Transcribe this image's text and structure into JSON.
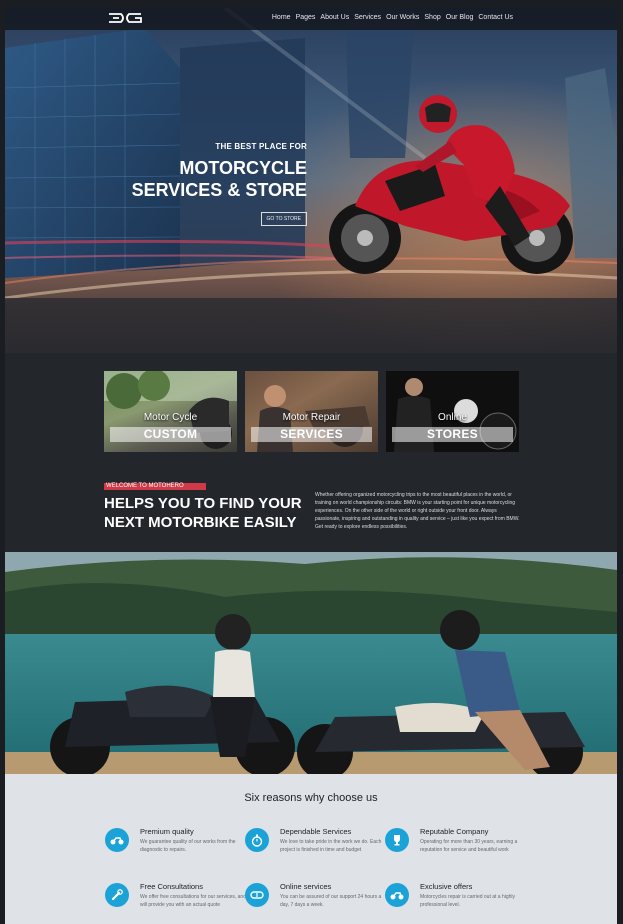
{
  "nav": {
    "items": [
      "Home",
      "Pages",
      "About Us",
      "Services",
      "Our Works",
      "Shop",
      "Our Blog",
      "Contact Us"
    ]
  },
  "hero": {
    "kicker": "THE BEST PLACE FOR",
    "title_line1": "MOTORCYCLE",
    "title_line2": "SERVICES & STORE",
    "button": "GO TO STORE"
  },
  "cards": [
    {
      "small": "Motor Cycle",
      "big": "CUSTOM"
    },
    {
      "small": "Motor Repair",
      "big": "SERVICES"
    },
    {
      "small": "Online",
      "big": "STORES"
    }
  ],
  "welcome": {
    "tag": "WELCOME TO MOTOHERO",
    "title_line1": "HELPS YOU TO FIND YOUR",
    "title_line2": "NEXT MOTORBIKE EASILY",
    "body": "Whether offering organized motorcycling trips to the most beautiful places in the world, or training on world championship circuits: BMW is your starting point for unique motorcycling experiences. On the other side of the world or right outside your front door. Always passionate, inspiring and outstanding in quality and service – just like you expect from BMW. Get ready to explore endless possibilities."
  },
  "reasons": {
    "title": "Six reasons why choose us",
    "items": [
      {
        "name": "Premium quality",
        "desc": "We guarantee quality of our works from the diagnostic to repairs.",
        "icon": "motorbike-icon"
      },
      {
        "name": "Dependable Services",
        "desc": "We love to take pride in the work we do. Each project is finished in time and budget",
        "icon": "stopwatch-icon"
      },
      {
        "name": "Reputable Company",
        "desc": "Operating for more than 30 years, earning a reputation for service and beautiful work",
        "icon": "trophy-icon"
      },
      {
        "name": "Free Consultations",
        "desc": "We offer free consultations for our services, and will provide you with an actual quote",
        "icon": "wrench-icon"
      },
      {
        "name": "Online services",
        "desc": "You can be assured of our support 24 hours a day, 7 days a week.",
        "icon": "goggles-icon"
      },
      {
        "name": "Exclusive offers",
        "desc": "Motorcycles repair is carried out at a highly professional level.",
        "icon": "motorbike-icon"
      }
    ]
  },
  "colors": {
    "accent_red": "#d03a48",
    "icon_blue": "#1ba3d8",
    "dark_bg": "#23272c",
    "light_bg": "#dfe3e8"
  }
}
